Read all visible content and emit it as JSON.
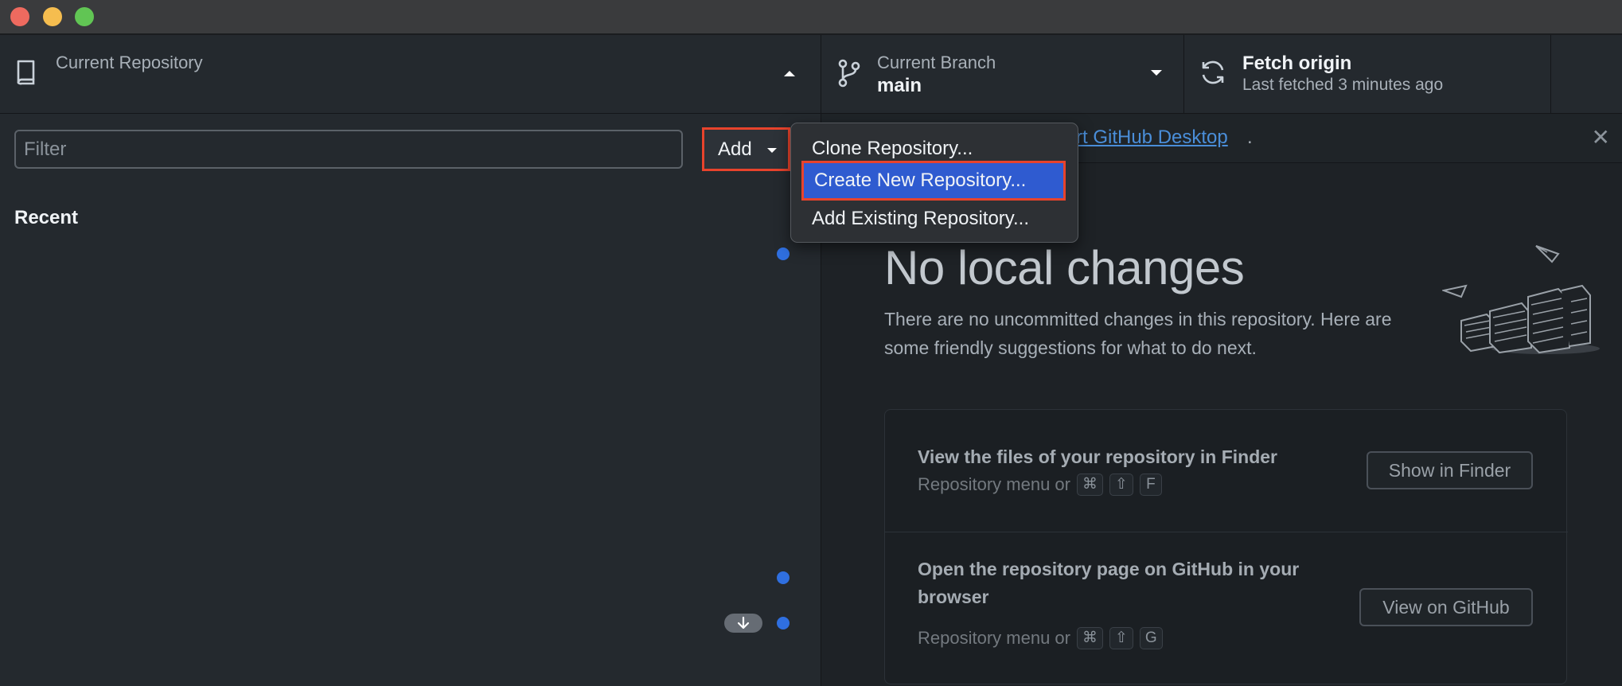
{
  "window": {
    "traffic_lights": [
      "close",
      "minimize",
      "zoom"
    ]
  },
  "toolbar": {
    "repo_label": "Current Repository",
    "branch_label": "Current Branch",
    "branch_name": "main",
    "fetch_title": "Fetch origin",
    "fetch_sub": "Last fetched 3 minutes ago"
  },
  "sidebar": {
    "filter_placeholder": "Filter",
    "add_label": "Add",
    "recent_heading": "Recent"
  },
  "add_menu": {
    "items": [
      "Clone Repository...",
      "Create New Repository...",
      "Add Existing Repository..."
    ],
    "selected_index": 1
  },
  "notice": {
    "link_text": "rt GitHub Desktop",
    "trailing": "."
  },
  "main": {
    "title": "No local changes",
    "description": "There are no uncommitted changes in this repository. Here are some friendly suggestions for what to do next."
  },
  "suggestions": [
    {
      "title": "View the files of your repository in Finder",
      "sub_prefix": "Repository menu or",
      "keys": [
        "⌘",
        "⇧",
        "F"
      ],
      "button": "Show in Finder"
    },
    {
      "title": "Open the repository page on GitHub in your browser",
      "sub_prefix": "Repository menu or",
      "keys": [
        "⌘",
        "⇧",
        "G"
      ],
      "button": "View on GitHub"
    }
  ],
  "colors": {
    "accent_blue": "#2f5bd0",
    "highlight_red": "#e8432c",
    "dot_blue": "#2f6fe0"
  }
}
